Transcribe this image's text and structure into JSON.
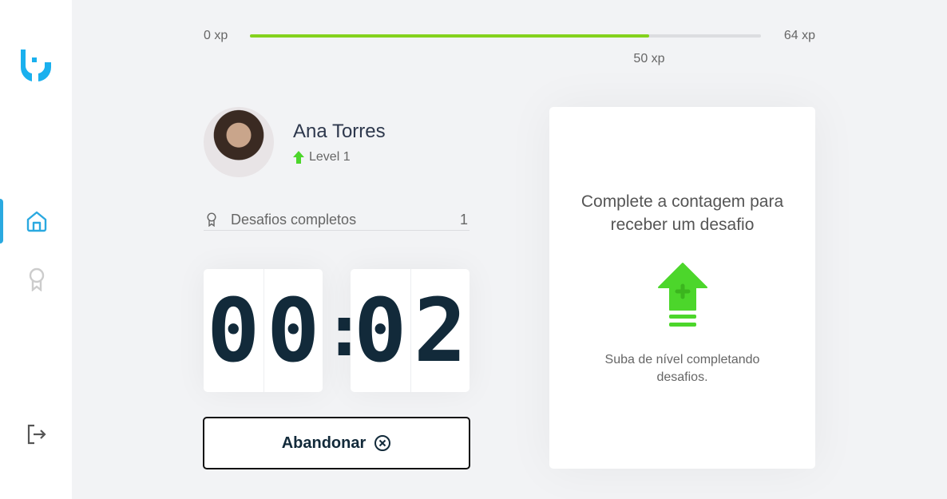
{
  "sidebar": {
    "nav": [
      {
        "name": "home",
        "active": true
      },
      {
        "name": "leaderboard",
        "active": false
      },
      {
        "name": "logout"
      }
    ]
  },
  "xp": {
    "min_label": "0 xp",
    "max_label": "64 xp",
    "current_label": "50 xp",
    "current": 50,
    "max": 64
  },
  "profile": {
    "name": "Ana Torres",
    "level": "Level 1"
  },
  "completed": {
    "label": "Desafios completos",
    "count": "1"
  },
  "timer": {
    "minutes": [
      "0",
      "0"
    ],
    "seconds": [
      "0",
      "2"
    ],
    "separator": ":"
  },
  "abandon_label": "Abandonar",
  "challenge": {
    "title": "Complete a contagem para receber um desafio",
    "hint": "Suba de nível completando desafios."
  },
  "colors": {
    "accent": "#2aa9e0",
    "xp": "#84d21d",
    "green": "#4cd62b"
  }
}
